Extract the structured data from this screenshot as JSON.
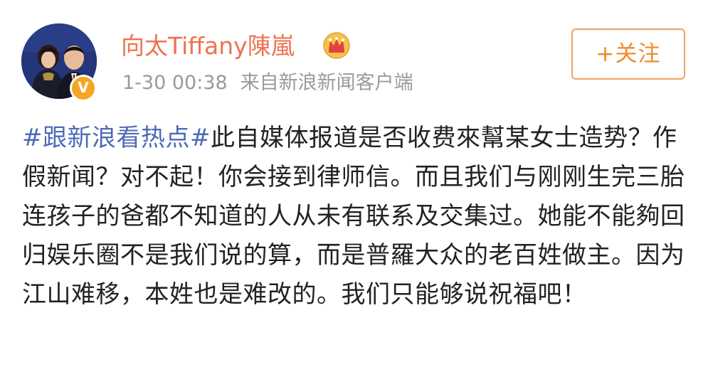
{
  "post": {
    "author": {
      "name": "向太Tiffany陳嵐",
      "avatar_icon": "avatar",
      "verified_icon": "verified-v-badge-icon",
      "verified_badge_text": "V",
      "member_icon": "crown-vip-icon"
    },
    "meta": {
      "time": "1-30 00:38",
      "source": "来自新浪新闻客户端"
    },
    "follow_button": {
      "label": "+关注"
    },
    "content": {
      "hashtag": "#跟新浪看热点#",
      "text": "此自媒体报道是否收费來幫某女士造势？作假新闻？对不起！你会接到律师信。而且我们与刚刚生完三胎连孩子的爸都不知道的人从未有联系及交集过。她能不能夠回归娱乐圈不是我们说的算，而是普羅大众的老百姓做主。因为江山难移，本姓也是难改的。我们只能够说祝福吧！"
    }
  },
  "colors": {
    "username": "#eb7350",
    "hashtag": "#4d6ab7",
    "meta": "#9a9a9a",
    "follow": "#f08a2c",
    "body_text": "#222222",
    "badge": "#f5a623"
  }
}
